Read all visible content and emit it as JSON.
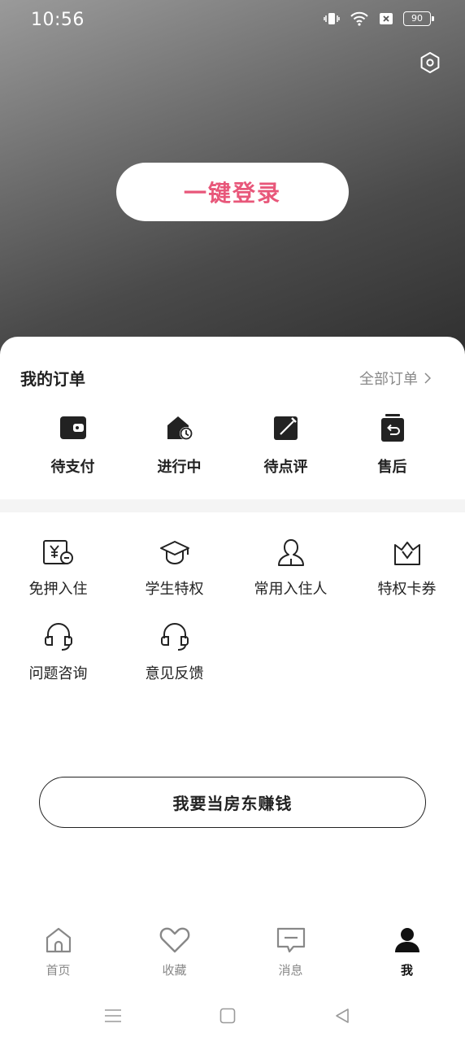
{
  "status_bar": {
    "time": "10:56",
    "battery": "90"
  },
  "header": {
    "login_label": "一键登录"
  },
  "orders": {
    "title": "我的订单",
    "all_label": "全部订单",
    "items": [
      {
        "label": "待支付",
        "icon": "wallet-icon"
      },
      {
        "label": "进行中",
        "icon": "house-clock-icon"
      },
      {
        "label": "待点评",
        "icon": "edit-icon"
      },
      {
        "label": "售后",
        "icon": "return-icon"
      }
    ]
  },
  "features": {
    "items": [
      {
        "label": "免押入住",
        "icon": "deposit-free-icon"
      },
      {
        "label": "学生特权",
        "icon": "graduation-cap-icon"
      },
      {
        "label": "常用入住人",
        "icon": "person-icon"
      },
      {
        "label": "特权卡券",
        "icon": "crown-icon"
      },
      {
        "label": "问题咨询",
        "icon": "headset-icon"
      },
      {
        "label": "意见反馈",
        "icon": "headset-icon"
      }
    ]
  },
  "landlord_label": "我要当房东赚钱",
  "tabbar": {
    "items": [
      {
        "label": "首页",
        "icon": "home-icon"
      },
      {
        "label": "收藏",
        "icon": "heart-icon"
      },
      {
        "label": "消息",
        "icon": "message-icon"
      },
      {
        "label": "我",
        "icon": "user-icon"
      }
    ],
    "active": "我"
  },
  "colors": {
    "accent": "#e8577a",
    "text": "#222222",
    "muted": "#8a8a8a"
  }
}
